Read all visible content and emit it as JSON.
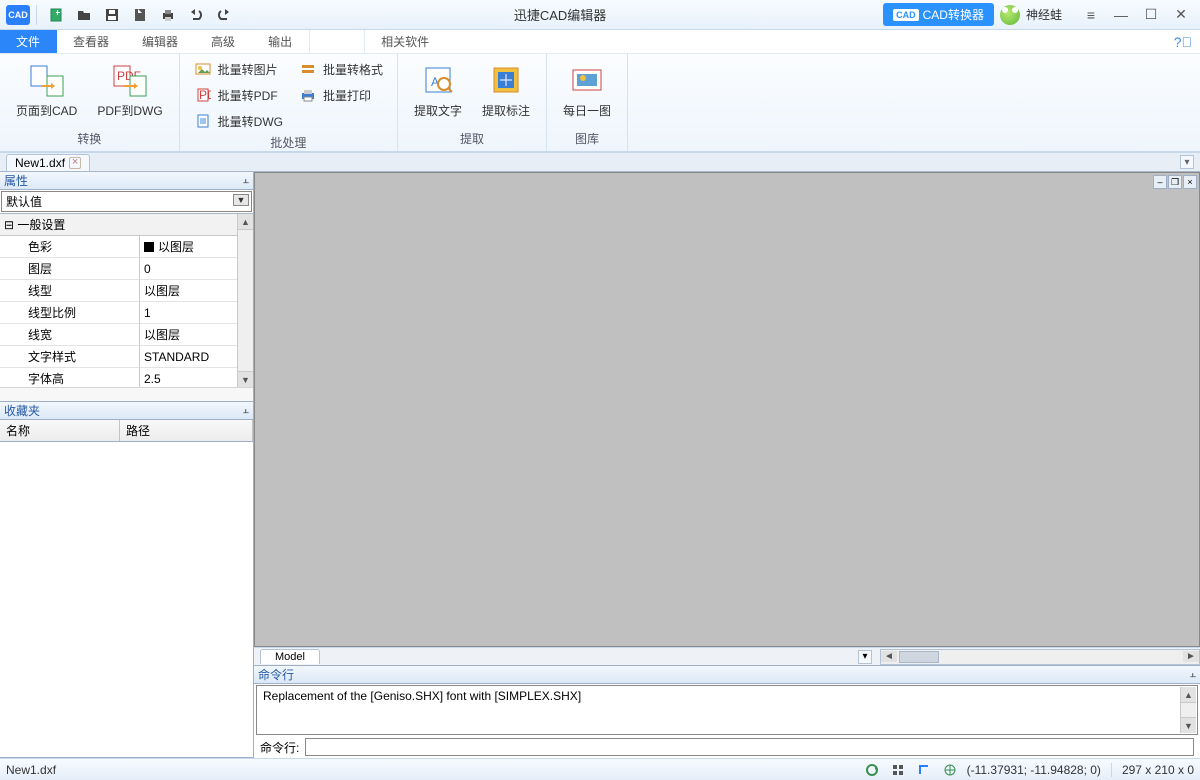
{
  "title": "迅捷CAD编辑器",
  "cad_converter_btn": "CAD转换器",
  "user_name": "神经蛙",
  "menu": {
    "tabs": [
      "文件",
      "查看器",
      "编辑器",
      "高级",
      "输出"
    ],
    "related": "相关软件",
    "active_index": 0
  },
  "ribbon": {
    "convert": {
      "label": "转换",
      "page_to_cad": "页面到CAD",
      "pdf_to_dwg": "PDF到DWG"
    },
    "batch": {
      "label": "批处理",
      "to_image": "批量转图片",
      "to_pdf": "批量转PDF",
      "to_dwg": "批量转DWG",
      "to_format": "批量转格式",
      "print": "批量打印"
    },
    "extract": {
      "label": "提取",
      "text": "提取文字",
      "annot": "提取标注"
    },
    "gallery": {
      "label": "图库",
      "daily": "每日一图"
    }
  },
  "doc_tab": "New1.dxf",
  "properties": {
    "title": "属性",
    "selector": "默认值",
    "section": "一般设置",
    "rows": [
      {
        "label": "色彩",
        "value": "以图层",
        "swatch": true
      },
      {
        "label": "图层",
        "value": "0"
      },
      {
        "label": "线型",
        "value": "以图层"
      },
      {
        "label": "线型比例",
        "value": "1"
      },
      {
        "label": "线宽",
        "value": "以图层"
      },
      {
        "label": "文字样式",
        "value": "STANDARD"
      },
      {
        "label": "字体高",
        "value": "2.5"
      }
    ]
  },
  "favorites": {
    "title": "收藏夹",
    "col_name": "名称",
    "col_path": "路径"
  },
  "model_tab": "Model",
  "command": {
    "title": "命令行",
    "output": "Replacement of the [Geniso.SHX] font with [SIMPLEX.SHX]",
    "prompt": "命令行:"
  },
  "status": {
    "file": "New1.dxf",
    "coords": "(-11.37931; -11.94828; 0)",
    "dims": "297 x 210 x 0"
  }
}
